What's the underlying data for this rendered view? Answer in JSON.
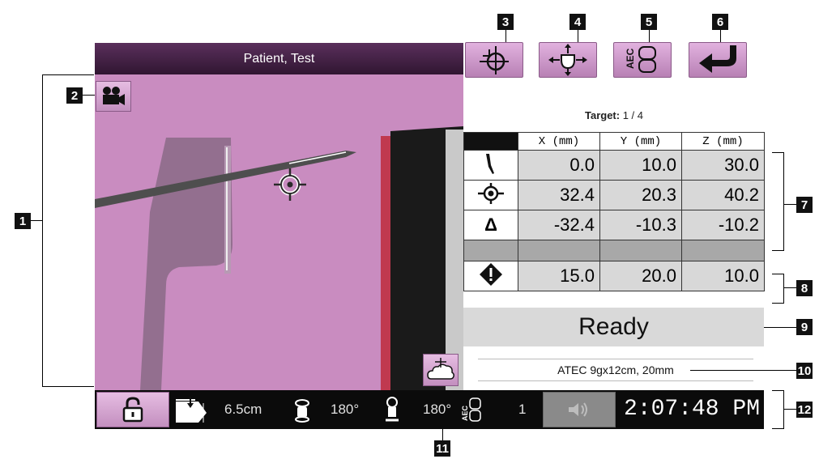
{
  "header": {
    "patient_name": "Patient, Test"
  },
  "callouts": [
    "1",
    "2",
    "3",
    "4",
    "5",
    "6",
    "7",
    "8",
    "9",
    "10",
    "11",
    "12"
  ],
  "toolbar": {
    "buttons": [
      {
        "icon": "crosshair-target-icon"
      },
      {
        "icon": "move-arrows-icon"
      },
      {
        "icon": "aec-icon",
        "label": "AEC"
      },
      {
        "icon": "return-arrow-icon"
      }
    ]
  },
  "target": {
    "label": "Target:",
    "value": "1 / 4"
  },
  "table": {
    "headers": [
      "X (mm)",
      "Y (mm)",
      "Z (mm)"
    ],
    "rows": [
      {
        "icon": "needle-icon",
        "values": [
          "0.0",
          "10.0",
          "30.0"
        ]
      },
      {
        "icon": "target-icon",
        "values": [
          "32.4",
          "20.3",
          "40.2"
        ]
      },
      {
        "icon": "delta-icon",
        "symbol": "Δ",
        "values": [
          "-32.4",
          "-10.3",
          "-10.2"
        ]
      },
      {
        "icon": "warning-diamond-icon",
        "values": [
          "15.0",
          "20.0",
          "10.0"
        ]
      }
    ]
  },
  "status": {
    "ready": "Ready"
  },
  "atec": {
    "text": "ATEC 9gx12cm, 20mm"
  },
  "statusbar": {
    "compression": "6.5cm",
    "angle1": "180°",
    "angle2": "180°",
    "aec_label": "AEC",
    "aec_value": "1",
    "clock": "2:07:48 PM"
  },
  "colors": {
    "view_background": "#c98cc0",
    "button_pink": "#d7a3d3",
    "title_bar": "#3c1d3e",
    "cell_gray": "#d8d8d8"
  }
}
